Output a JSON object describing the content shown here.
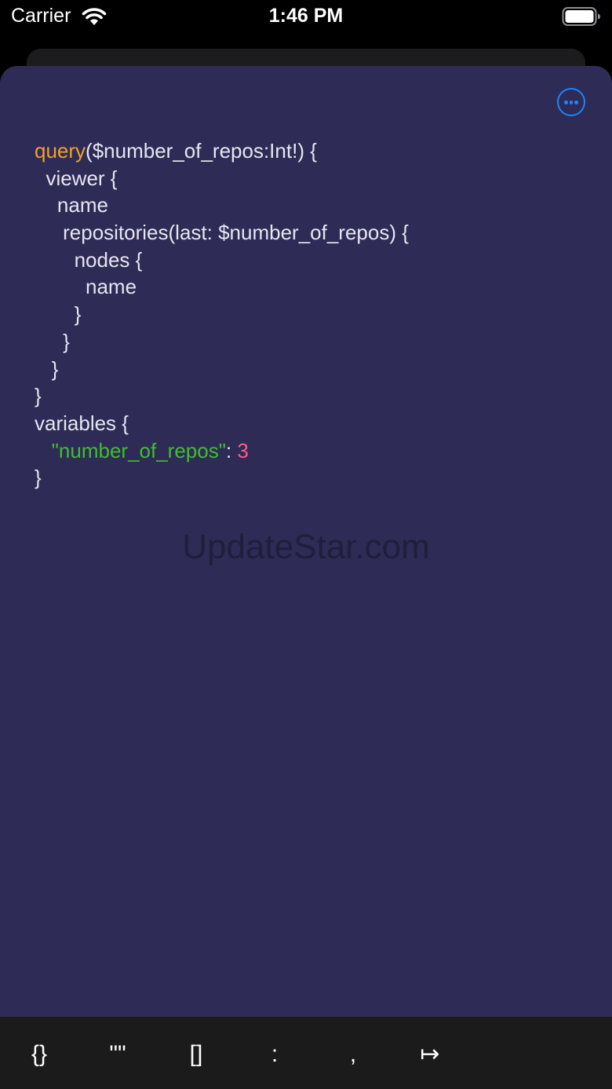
{
  "status_bar": {
    "carrier": "Carrier",
    "time": "1:46 PM",
    "icons": [
      "wifi-icon",
      "battery-icon"
    ]
  },
  "editor": {
    "more_button_icon": "ellipsis-circle-icon",
    "lines": [
      [
        {
          "t": "query",
          "c": "kw"
        },
        {
          "t": "($number_of_repos:Int!) {",
          "c": "plain"
        }
      ],
      [
        {
          "t": "  viewer {",
          "c": "plain"
        }
      ],
      [
        {
          "t": "    name",
          "c": "plain"
        }
      ],
      [
        {
          "t": "     repositories(last: $number_of_repos) {",
          "c": "plain"
        }
      ],
      [
        {
          "t": "       nodes {",
          "c": "plain"
        }
      ],
      [
        {
          "t": "         name",
          "c": "plain"
        }
      ],
      [
        {
          "t": "       }",
          "c": "plain"
        }
      ],
      [
        {
          "t": "     }",
          "c": "plain"
        }
      ],
      [
        {
          "t": "   }",
          "c": "plain"
        }
      ],
      [
        {
          "t": "}",
          "c": "plain"
        }
      ],
      [
        {
          "t": "variables {",
          "c": "plain"
        }
      ],
      [
        {
          "t": "   ",
          "c": "plain"
        },
        {
          "t": "\"number_of_repos\"",
          "c": "str"
        },
        {
          "t": ": ",
          "c": "plain"
        },
        {
          "t": "3",
          "c": "num"
        }
      ],
      [
        {
          "t": "}",
          "c": "plain"
        }
      ]
    ]
  },
  "watermark": "UpdateStar.com",
  "accessory_bar": {
    "keys": [
      {
        "name": "braces-key",
        "label": "{}"
      },
      {
        "name": "quotes-key",
        "label": "\"\""
      },
      {
        "name": "brackets-key",
        "label": "[]"
      },
      {
        "name": "colon-key",
        "label": ":"
      },
      {
        "name": "comma-key",
        "label": ","
      },
      {
        "name": "tab-key",
        "label": "↦"
      }
    ]
  },
  "colors": {
    "sheet_background": "#2e2b56",
    "keyword": "#f0a12a",
    "string": "#3fbf2d",
    "number": "#ff5a86",
    "accent": "#1a84ff",
    "accessory_background": "#1b1b1b"
  }
}
